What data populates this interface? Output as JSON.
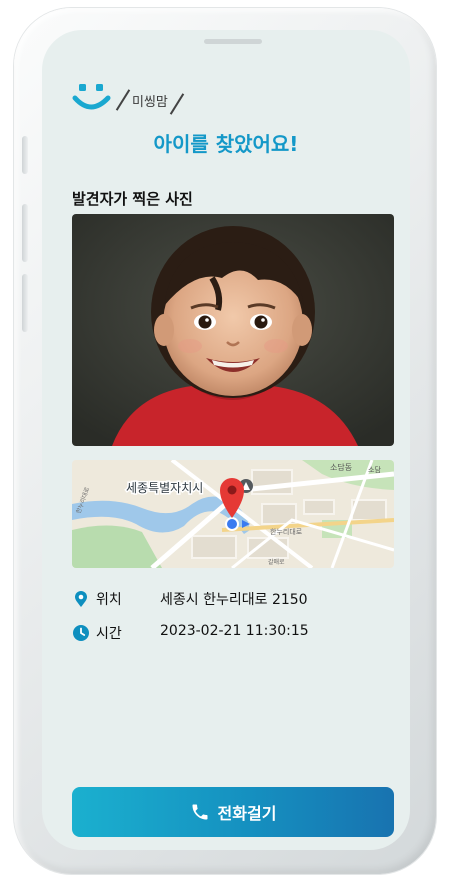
{
  "header": {
    "brand_name": "미씽맘",
    "headline": "아이를 찾았어요!"
  },
  "photo_section": {
    "title": "발견자가 찍은 사진"
  },
  "map": {
    "labels": {
      "city": "세종특별자치시",
      "district_top": "소담동",
      "district_right": "소담",
      "road_1": "한누리대로",
      "road_2": "한누리대로",
      "road_3": "갈매로"
    }
  },
  "info": {
    "location_label": "위치",
    "location_value": "세종시 한누리대로 2150",
    "time_label": "시간",
    "time_value": "2023-02-21 11:30:15"
  },
  "actions": {
    "call_label": "전화걸기"
  },
  "colors": {
    "accent": "#1498c8",
    "screen_bg": "#e7efee",
    "icon_blue": "#0e8fbf",
    "button_start": "#1bb0cf",
    "button_end": "#1873b0",
    "pin_red": "#e53935"
  }
}
